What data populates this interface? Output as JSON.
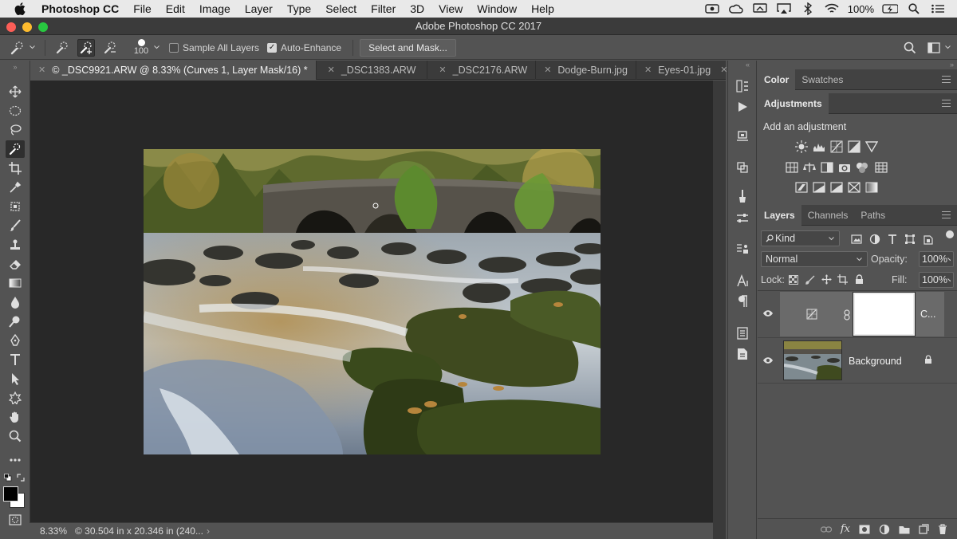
{
  "menubar": {
    "app": "Photoshop CC",
    "items": [
      "File",
      "Edit",
      "Image",
      "Layer",
      "Type",
      "Select",
      "Filter",
      "3D",
      "View",
      "Window",
      "Help"
    ],
    "battery": "100%"
  },
  "window": {
    "title": "Adobe Photoshop CC 2017"
  },
  "options": {
    "brush_size": "100",
    "sample_all_layers": "Sample All Layers",
    "sample_all_checked": false,
    "auto_enhance": "Auto-Enhance",
    "auto_enhance_checked": true,
    "select_mask_button": "Select and Mask..."
  },
  "tabs": [
    {
      "label": "© _DSC9921.ARW @ 8.33% (Curves 1, Layer Mask/16) *",
      "active": true
    },
    {
      "label": "_DSC1383.ARW",
      "active": false
    },
    {
      "label": "_DSC2176.ARW",
      "active": false
    },
    {
      "label": "Dodge-Burn.jpg",
      "active": false
    },
    {
      "label": "Eyes-01.jpg",
      "active": false
    }
  ],
  "status": {
    "zoom": "8.33%",
    "doc_info": "© 30.504 in x 20.346 in (240..."
  },
  "panels": {
    "top_tabs": [
      "Color",
      "Swatches"
    ],
    "adjustments_tab": "Adjustments",
    "add_adjustment": "Add an adjustment",
    "layers_tabs": [
      "Layers",
      "Channels",
      "Paths"
    ],
    "kind_label": "Kind",
    "blend_mode": "Normal",
    "opacity_label": "Opacity:",
    "opacity_value": "100%",
    "lock_label": "Lock:",
    "fill_label": "Fill:",
    "fill_value": "100%",
    "layers": [
      {
        "name": "C...",
        "type": "curves"
      },
      {
        "name": "Background",
        "type": "image"
      }
    ]
  }
}
